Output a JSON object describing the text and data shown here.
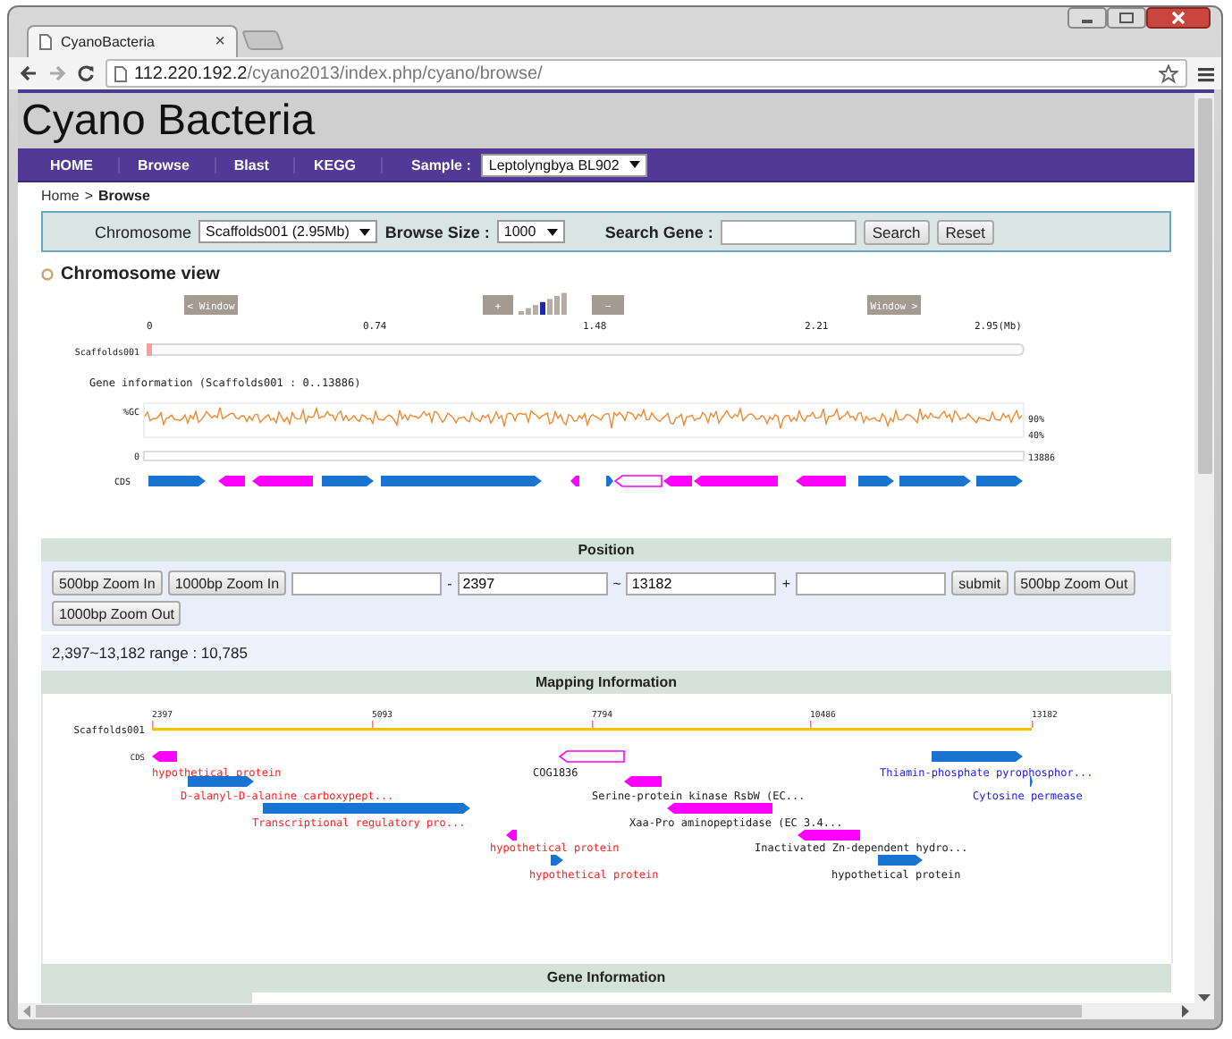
{
  "browser": {
    "tabs": [
      {
        "title": "CyanoBacteria",
        "close": "×",
        "selected": true
      }
    ],
    "url_host": "112.220.192.2",
    "url_path": "/cyano2013/index.php/cyano/browse/"
  },
  "site_title": "Cyano Bacteria",
  "nav": {
    "items": [
      "HOME",
      "Browse",
      "Blast",
      "KEGG"
    ],
    "sample_label": "Sample :",
    "sample_value": "Leptolyngbya BL902"
  },
  "breadcrumb": {
    "home": "Home",
    "separator": ">",
    "current": "Browse"
  },
  "search_bar": {
    "chromosome_label": "Chromosome",
    "chromosome_value": "Scaffolds001 (2.95Mb)",
    "browse_size_label": "Browse Size :",
    "browse_size_value": "1000",
    "search_label": "Search Gene :",
    "search_button": "Search",
    "reset_button": "Reset"
  },
  "chromosome_view": {
    "title": "Chromosome view",
    "prev_window": "< Window",
    "next_window": "Window >",
    "zoom_in": "+",
    "zoom_out": "−",
    "zoom_levels": [
      {
        "selected": false
      },
      {
        "selected": false
      },
      {
        "selected": false
      },
      {
        "selected": true
      },
      {
        "selected": false
      },
      {
        "selected": false
      },
      {
        "selected": false
      }
    ],
    "axis_labels": [
      "0",
      "0.74",
      "1.48",
      "2.21",
      "2.95(Mb)"
    ],
    "scaffold_label": "Scaffolds001",
    "gene_info": "Gene information (Scaffolds001 : 0..13886)",
    "gc_label": "%GC",
    "gc_high": "90%",
    "gc_low": "40%",
    "track_start": "0",
    "track_end": "13886",
    "cds_label": "CDS",
    "cds": [
      {
        "kind": "forward",
        "highlighted": false
      },
      {
        "kind": "reverse",
        "highlighted": false
      },
      {
        "kind": "reverse",
        "highlighted": false
      },
      {
        "kind": "forward",
        "highlighted": false
      },
      {
        "kind": "forward",
        "highlighted": false
      },
      {
        "kind": "reverse",
        "highlighted": false
      },
      {
        "kind": "forward",
        "highlighted": false
      },
      {
        "kind": "reverse",
        "highlighted": true
      },
      {
        "kind": "reverse",
        "highlighted": false
      },
      {
        "kind": "reverse",
        "highlighted": false
      },
      {
        "kind": "reverse",
        "highlighted": false
      },
      {
        "kind": "forward",
        "highlighted": false
      },
      {
        "kind": "forward",
        "highlighted": false
      },
      {
        "kind": "forward",
        "highlighted": false
      }
    ]
  },
  "position": {
    "title": "Position",
    "controls": [
      {
        "kind": "button",
        "label": "500bp Zoom In"
      },
      {
        "kind": "button",
        "label": "1000bp Zoom In"
      },
      {
        "kind": "field"
      },
      {
        "kind": "separator",
        "label": "-"
      },
      {
        "kind": "field",
        "value": "2397"
      },
      {
        "kind": "separator",
        "label": "~"
      },
      {
        "kind": "field",
        "value": "13182"
      },
      {
        "kind": "separator",
        "label": "+"
      },
      {
        "kind": "field"
      },
      {
        "kind": "button",
        "label": "submit"
      },
      {
        "kind": "button",
        "label": "500bp Zoom Out"
      },
      {
        "kind": "button",
        "label": "1000bp Zoom Out"
      }
    ],
    "range_text": "2,397~13,182 range : 10,785"
  },
  "mapping": {
    "title": "Mapping Information",
    "scaffold_label": "Scaffolds001",
    "ticks": [
      "2397",
      "5093",
      "7794",
      "10486",
      "13182"
    ],
    "cds_label": "CDS",
    "genes": [
      {
        "label": "hypothetical protein",
        "color": "#ff2020",
        "kind": "reverse",
        "highlighted": false
      },
      {
        "label": "COG1836",
        "color": "#202020",
        "kind": "reverse",
        "highlighted": true
      },
      {
        "label": "Thiamin-phosphate pyrophosphor...",
        "color": "#1a1aff",
        "kind": "forward",
        "highlighted": false
      },
      {
        "label": "D-alanyl-D-alanine carboxypept...",
        "color": "#ff2020",
        "kind": "forward",
        "highlighted": false
      },
      {
        "label": "Serine-protein kinase RsbW (EC...",
        "color": "#202020",
        "kind": "reverse",
        "highlighted": false
      },
      {
        "label": "Cytosine permease",
        "color": "#1a1aff",
        "kind": "forward",
        "highlighted": false
      },
      {
        "label": "Transcriptional regulatory pro...",
        "color": "#ff2020",
        "kind": "forward",
        "highlighted": false
      },
      {
        "label": "Xaa-Pro aminopeptidase (EC 3.4...",
        "color": "#202020",
        "kind": "reverse",
        "highlighted": false
      },
      {
        "label": "hypothetical protein",
        "color": "#ff2020",
        "kind": "reverse",
        "highlighted": false
      },
      {
        "label": "Inactivated Zn-dependent hydro...",
        "color": "#202020",
        "kind": "reverse",
        "highlighted": false
      },
      {
        "label": "hypothetical protein",
        "color": "#ff2020",
        "kind": "forward",
        "highlighted": false
      },
      {
        "label": "hypothetical protein",
        "color": "#202020",
        "kind": "forward",
        "highlighted": false
      }
    ]
  },
  "gene_information": {
    "title": "Gene Information"
  }
}
